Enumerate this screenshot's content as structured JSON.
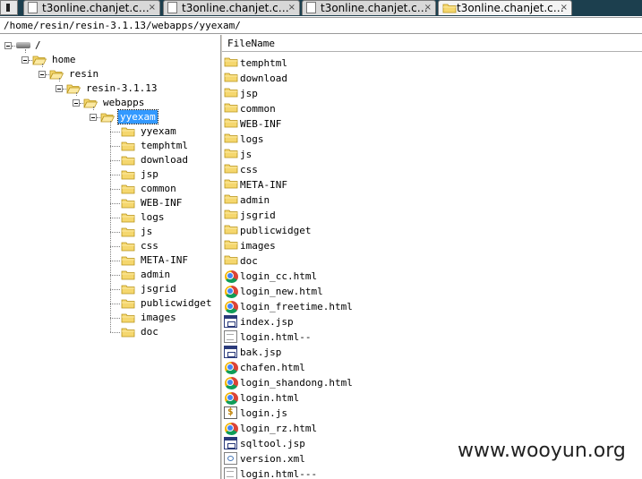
{
  "tabs": [
    {
      "label": "t3online.chanjet.c…",
      "icon": "page-icon",
      "active": false
    },
    {
      "label": "t3online.chanjet.c…",
      "icon": "page-icon",
      "active": false
    },
    {
      "label": "t3online.chanjet.c…",
      "icon": "page-icon",
      "active": false
    },
    {
      "label": "t3online.chanjet.c…",
      "icon": "folder-icon",
      "active": true
    }
  ],
  "tab_close_glyph": "×",
  "path": "/home/resin/resin-3.1.13/webapps/yyexam/",
  "tree": {
    "root": "/",
    "path_nodes": [
      "home",
      "resin",
      "resin-3.1.13",
      "webapps",
      "yyexam"
    ],
    "selected": "yyexam",
    "children": [
      "yyexam",
      "temphtml",
      "download",
      "jsp",
      "common",
      "WEB-INF",
      "logs",
      "js",
      "css",
      "META-INF",
      "admin",
      "jsgrid",
      "publicwidget",
      "images",
      "doc"
    ]
  },
  "file_list": {
    "column_header": "FileName",
    "files": [
      {
        "name": "temphtml",
        "icon": "folder-icon"
      },
      {
        "name": "download",
        "icon": "folder-icon"
      },
      {
        "name": "jsp",
        "icon": "folder-icon"
      },
      {
        "name": "common",
        "icon": "folder-icon"
      },
      {
        "name": "WEB-INF",
        "icon": "folder-icon"
      },
      {
        "name": "logs",
        "icon": "folder-icon"
      },
      {
        "name": "js",
        "icon": "folder-icon"
      },
      {
        "name": "css",
        "icon": "folder-icon"
      },
      {
        "name": "META-INF",
        "icon": "folder-icon"
      },
      {
        "name": "admin",
        "icon": "folder-icon"
      },
      {
        "name": "jsgrid",
        "icon": "folder-icon"
      },
      {
        "name": "publicwidget",
        "icon": "folder-icon"
      },
      {
        "name": "images",
        "icon": "folder-icon"
      },
      {
        "name": "doc",
        "icon": "folder-icon"
      },
      {
        "name": "login_cc.html",
        "icon": "chrome-html-icon"
      },
      {
        "name": "login_new.html",
        "icon": "chrome-html-icon"
      },
      {
        "name": "login_freetime.html",
        "icon": "chrome-html-icon"
      },
      {
        "name": "index.jsp",
        "icon": "jsp-file-icon"
      },
      {
        "name": "login.html--",
        "icon": "generic-file-icon"
      },
      {
        "name": "bak.jsp",
        "icon": "jsp-file-icon"
      },
      {
        "name": "chafen.html",
        "icon": "chrome-html-icon"
      },
      {
        "name": "login_shandong.html",
        "icon": "chrome-html-icon"
      },
      {
        "name": "login.html",
        "icon": "chrome-html-icon"
      },
      {
        "name": "login.js",
        "icon": "js-file-icon"
      },
      {
        "name": "login_rz.html",
        "icon": "chrome-html-icon"
      },
      {
        "name": "sqltool.jsp",
        "icon": "jsp-file-icon"
      },
      {
        "name": "version.xml",
        "icon": "xml-file-icon"
      },
      {
        "name": "login.html---",
        "icon": "generic-file-icon"
      }
    ]
  },
  "watermark": "www.wooyun.org",
  "colors": {
    "tabbar_bg": "#1c3f4e",
    "selection": "#3399ff",
    "folder_fill": "#f5d76e",
    "folder_edge": "#b8941a"
  }
}
